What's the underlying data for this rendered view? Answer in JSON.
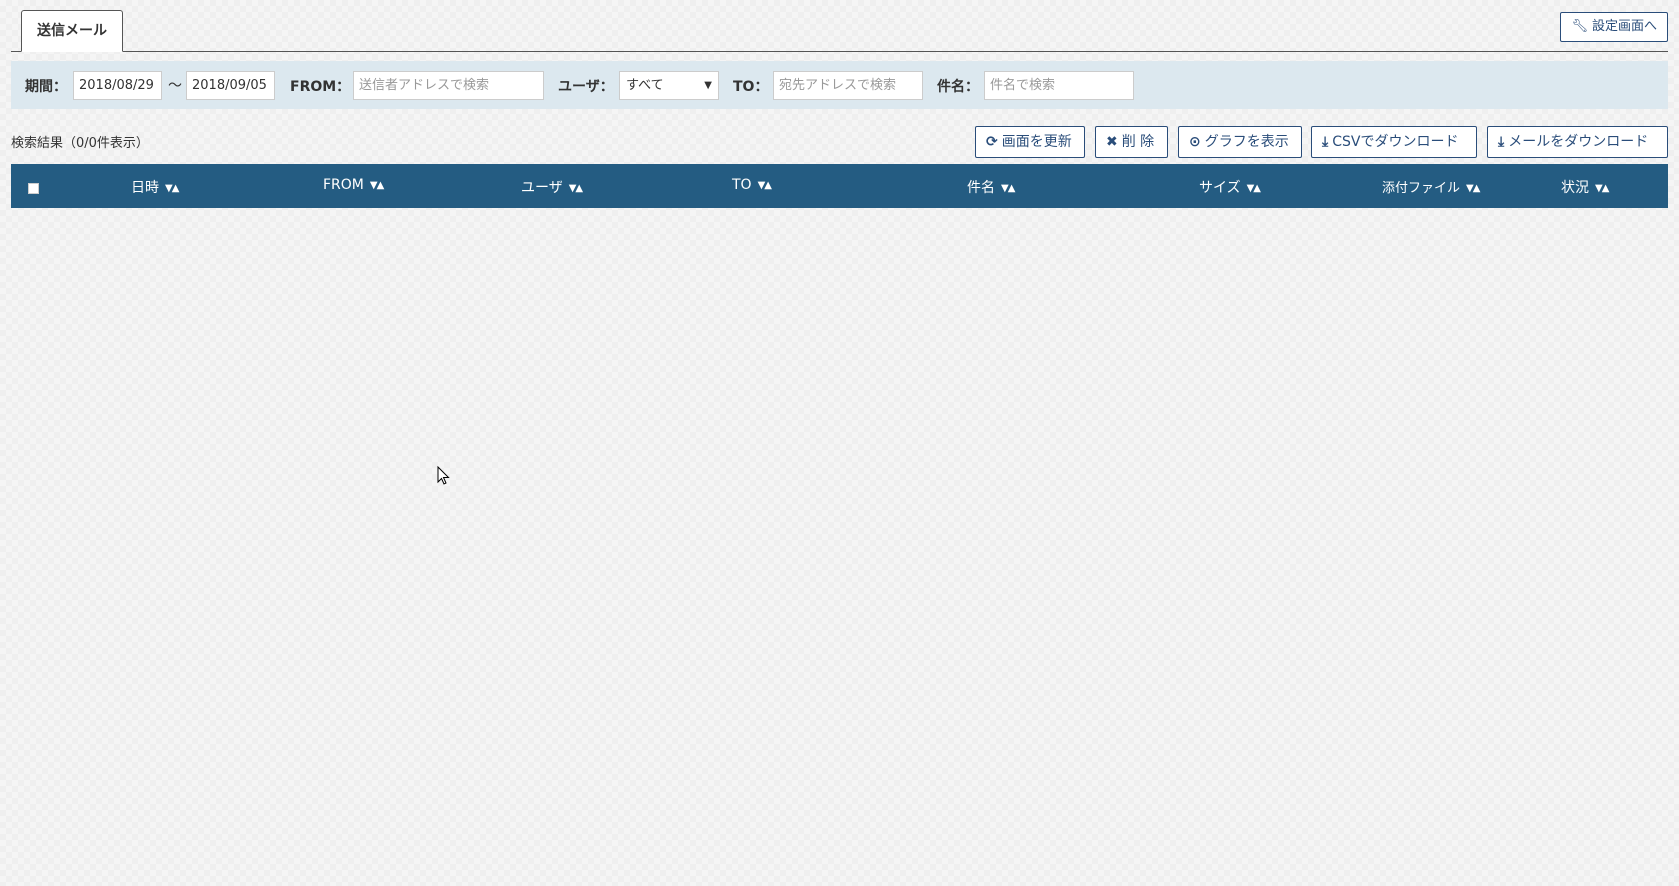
{
  "tabs": [
    {
      "label": "送信メール",
      "active": true
    }
  ],
  "settings_button": {
    "label": "設定画面へ",
    "icon": "wrench-icon"
  },
  "filters": {
    "period_label": "期間：",
    "date_from": "2018/08/29",
    "date_separator": "〜",
    "date_to": "2018/09/05",
    "from_label": "FROM：",
    "from_placeholder": "送信者アドレスで検索",
    "user_label": "ユーザ：",
    "user_selected": "すべて",
    "to_label": "TO：",
    "to_placeholder": "宛先アドレスで検索",
    "subject_label": "件名：",
    "subject_placeholder": "件名で検索"
  },
  "results": {
    "count_text": "検索結果（0/0件表示）"
  },
  "actions": [
    {
      "label": "画面を更新",
      "icon": "refresh-icon"
    },
    {
      "label": "削 除",
      "icon": "close-icon"
    },
    {
      "label": "グラフを表示",
      "icon": "circle-dot-icon"
    },
    {
      "label": "CSVでダウンロード",
      "icon": "download-icon"
    },
    {
      "label": "メールをダウンロード",
      "icon": "download-icon"
    }
  ],
  "table": {
    "columns": [
      {
        "label": "日時"
      },
      {
        "label": "FROM"
      },
      {
        "label": "ユーザ"
      },
      {
        "label": "TO"
      },
      {
        "label": "件名"
      },
      {
        "label": "サイズ"
      },
      {
        "label": "添付ファイル"
      },
      {
        "label": "状況"
      }
    ],
    "rows": []
  },
  "colors": {
    "header_bg": "#245c82",
    "filter_bg": "#dce8ef",
    "button_border": "#2a4d7a"
  }
}
